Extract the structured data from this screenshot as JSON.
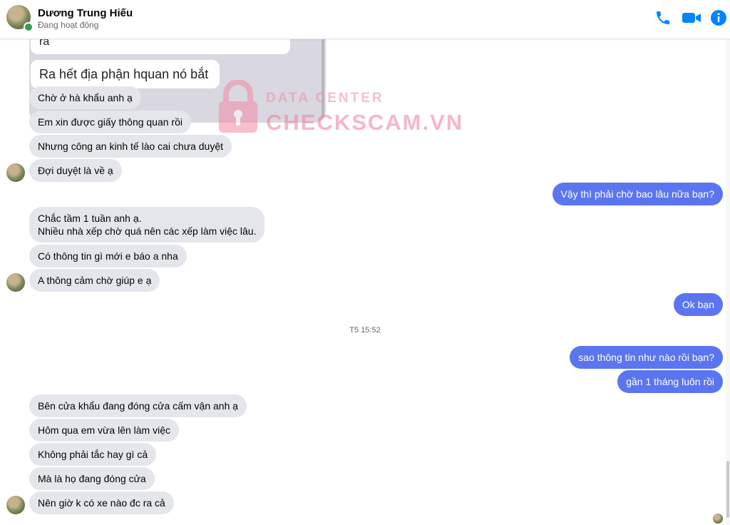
{
  "header": {
    "name": "Dương Trung Hiếu",
    "status": "Đang hoạt động",
    "accent_color": "#0084ff"
  },
  "screenshot": {
    "top_text": "ra",
    "text": "Ra hết địa phận hquan nó bắt"
  },
  "messages": {
    "m1": "Chờ ở hà khẩu anh ạ",
    "m2": "Em xin được giấy thông quan rồi",
    "m3": "Nhưng công an kinh tế lào cai chưa duyệt",
    "m4": "Đợi duyệt là về ạ",
    "m5": "Vậy thì phải chờ bao lâu nữa bạn?",
    "m6": "Chắc tầm 1 tuần anh ạ.\nNhiều nhà xếp chờ quá nên các xếp làm việc lâu.",
    "m7": "Có thông tin gì mới e báo a nha",
    "m8": "A thông cảm chờ giúp e ạ",
    "m9": "Ok bạn",
    "m10": "sao thông tin như nào rồi bạn?",
    "m11": "gần 1 tháng luôn rồi",
    "m12": "Bên cửa khẩu đang đóng cửa cấm vận anh ạ",
    "m13": "Hôm qua em vừa lên làm việc",
    "m14": "Không phải tắc hay gì cả",
    "m15": "Mà là họ đang đóng cửa",
    "m16": "Nên giờ k có xe nào đc ra cả"
  },
  "timestamp": "T5 15:52",
  "watermark": {
    "top": "DATA CENTER",
    "main": "CHECKSCAM.VN"
  },
  "icons": {
    "call": "phone-icon",
    "video": "video-camera-icon",
    "info": "info-icon",
    "lock": "lock-icon"
  }
}
